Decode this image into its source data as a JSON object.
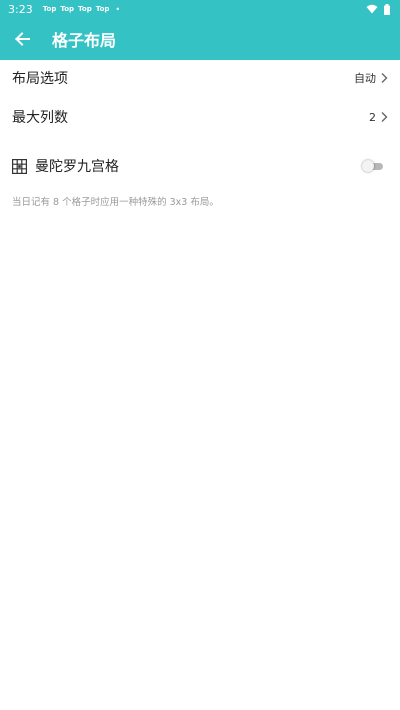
{
  "status_bar": {
    "time": "3:23",
    "notifications": [
      "Top",
      "Top",
      "Top",
      "Top"
    ],
    "dot": "•",
    "colors": {
      "background": "#35c2c4",
      "text": "#ffffff"
    }
  },
  "app_bar": {
    "title": "格子布局",
    "back_icon": "arrow-left-icon"
  },
  "settings": {
    "layout_option": {
      "label": "布局选项",
      "value": "自动"
    },
    "max_columns": {
      "label": "最大列数",
      "value": "2"
    },
    "mandala_grid": {
      "label": "曼陀罗九宫格",
      "enabled": false,
      "icon": "grid-icon"
    },
    "hint": "当日记有 8 个格子时应用一种特殊的 3x3 布局。"
  },
  "colors": {
    "accent": "#35c2c4",
    "text": "#222222",
    "hint": "#9a9a9a"
  }
}
